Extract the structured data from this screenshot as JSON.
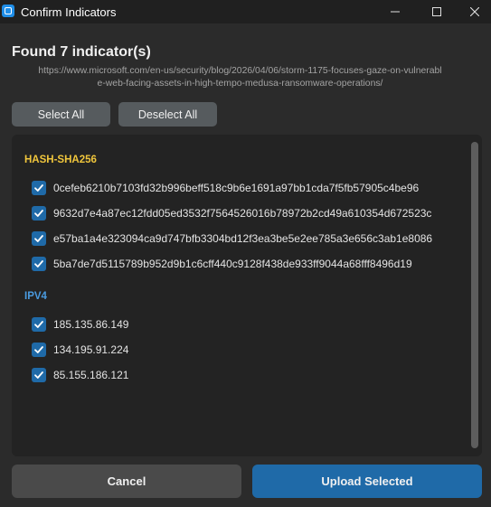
{
  "window": {
    "title": "Confirm Indicators"
  },
  "header": {
    "title": "Found 7 indicator(s)",
    "url_line1": "https://www.microsoft.com/en-us/security/blog/2026/04/06/storm-1175-focuses-gaze-on-vulnerabl",
    "url_line2": "e-web-facing-assets-in-high-tempo-medusa-ransomware-operations/"
  },
  "toolbar": {
    "select_all_label": "Select All",
    "deselect_all_label": "Deselect All"
  },
  "sections": [
    {
      "label": "HASH-SHA256",
      "color": "#f0c63c",
      "items": [
        {
          "value": "0cefeb6210b7103fd32b996beff518c9b6e1691a97bb1cda7f5fb57905c4be96",
          "checked": true
        },
        {
          "value": "9632d7e4a87ec12fdd05ed3532f7564526016b78972b2cd49a610354d672523c",
          "checked": true
        },
        {
          "value": "e57ba1a4e323094ca9d747bfb3304bd12f3ea3be5e2ee785a3e656c3ab1e8086",
          "checked": true
        },
        {
          "value": "5ba7de7d5115789b952d9b1c6cff440c9128f438de933ff9044a68fff8496d19",
          "checked": true
        }
      ]
    },
    {
      "label": "IPV4",
      "color": "#4a9be0",
      "items": [
        {
          "value": "185.135.86.149",
          "checked": true
        },
        {
          "value": "134.195.91.224",
          "checked": true
        },
        {
          "value": "85.155.186.121",
          "checked": true
        }
      ]
    }
  ],
  "footer": {
    "cancel_label": "Cancel",
    "upload_label": "Upload Selected"
  },
  "colors": {
    "accent": "#1f6aa8",
    "background": "#2b2b2b",
    "panel": "#232323"
  },
  "icons": {
    "app": "app-icon",
    "minimize": "minimize-icon",
    "maximize": "maximize-icon",
    "close": "close-icon",
    "check": "checkmark-icon"
  }
}
